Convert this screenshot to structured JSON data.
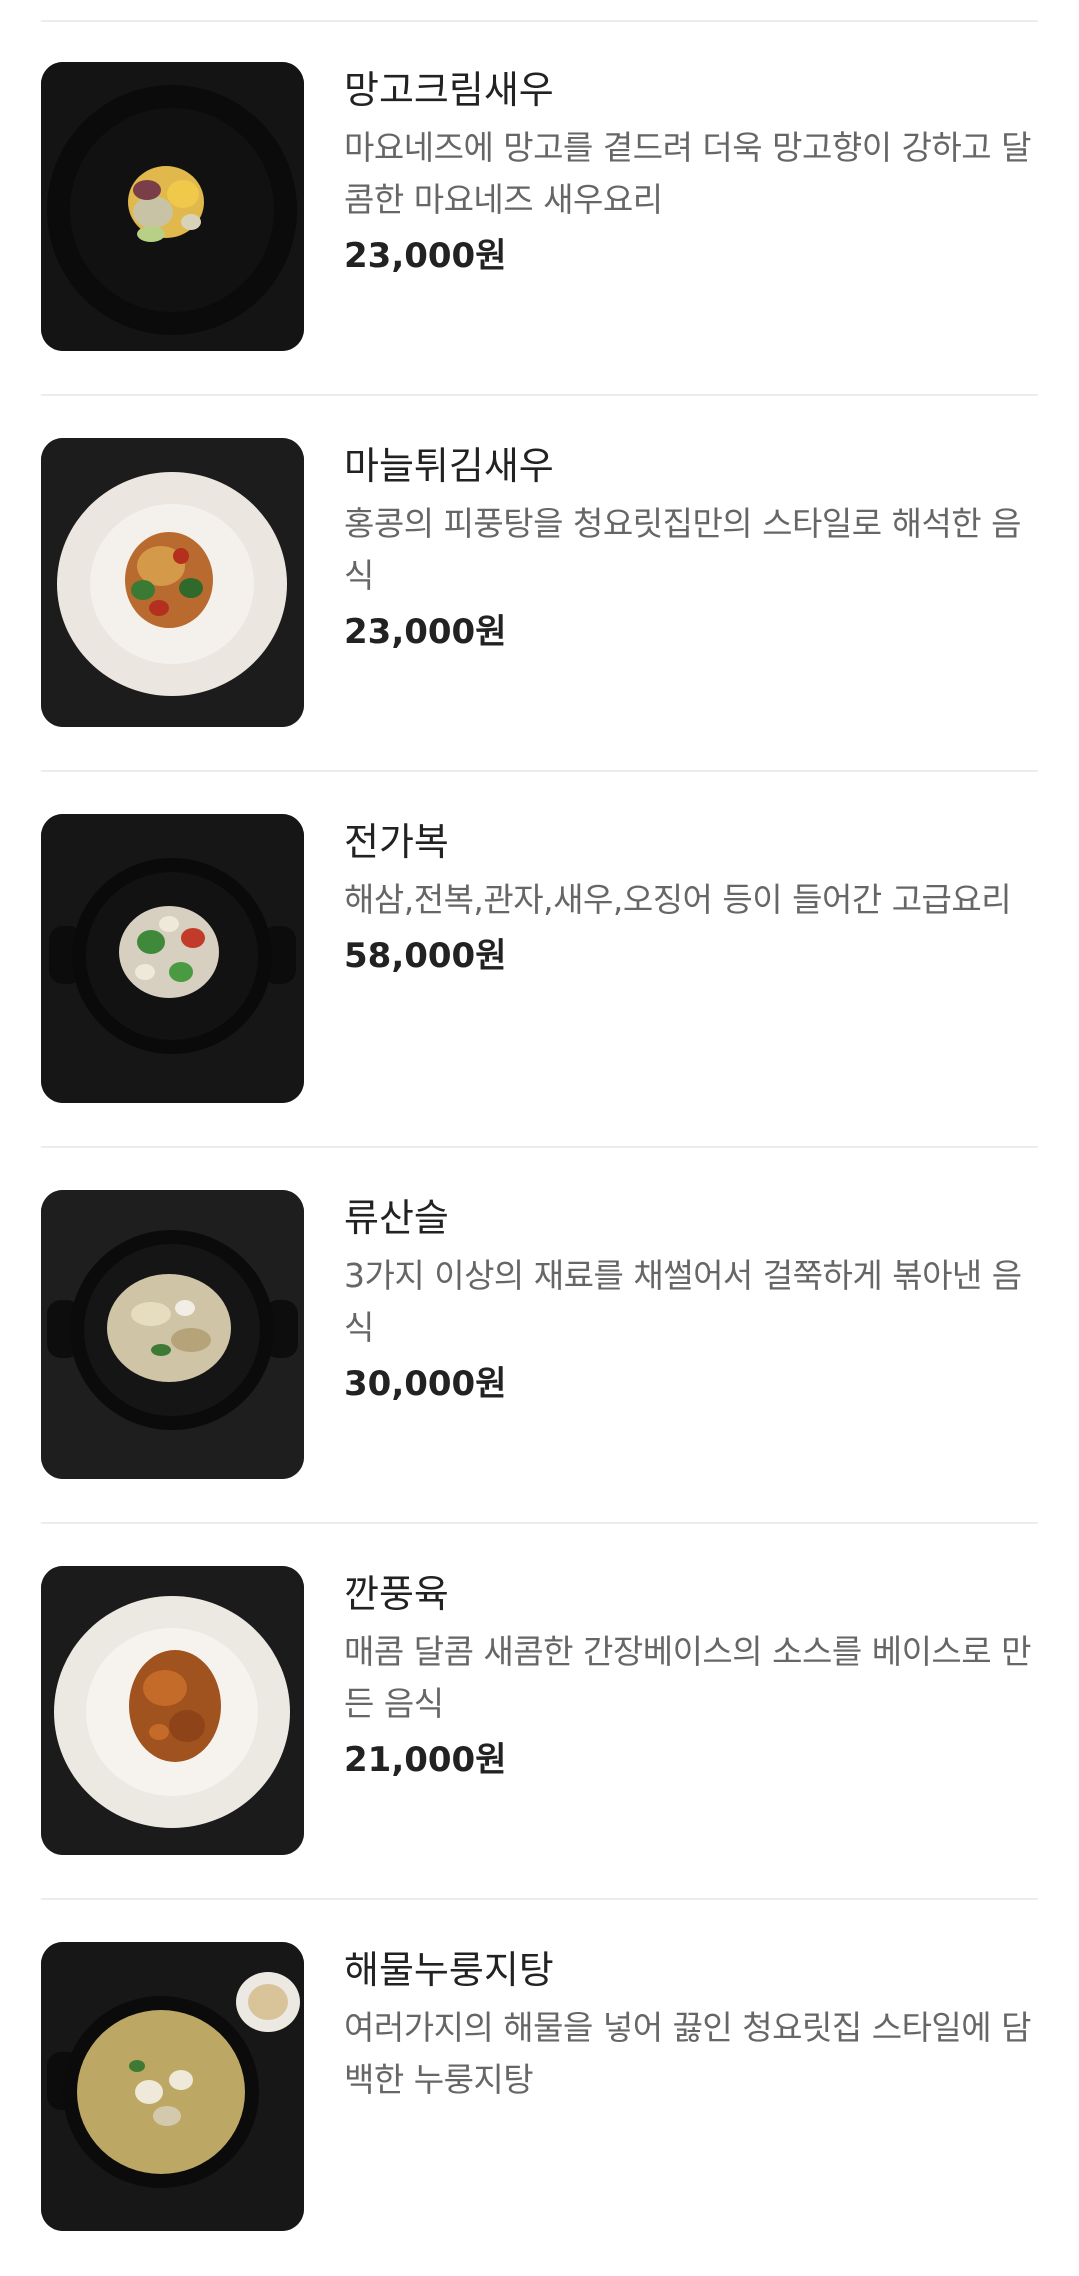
{
  "menu": {
    "items": [
      {
        "name": "망고크림새우",
        "description": "마요네즈에 망고를 곁드려 더욱 망고향이 강하고 달콤한 마요네즈 새우요리",
        "price": "23,000원",
        "image_icon": "food-photo-icon"
      },
      {
        "name": "마늘튀김새우",
        "description": "홍콩의 피풍탕을 청요릿집만의 스타일로 해석한 음식",
        "price": "23,000원",
        "image_icon": "food-photo-icon"
      },
      {
        "name": "전가복",
        "description": "해삼,전복,관자,새우,오징어 등이 들어간 고급요리",
        "price": "58,000원",
        "image_icon": "food-photo-icon"
      },
      {
        "name": "류산슬",
        "description": "3가지 이상의 재료를 채썰어서 걸쭉하게 볶아낸 음식",
        "price": "30,000원",
        "image_icon": "food-photo-icon"
      },
      {
        "name": "깐풍육",
        "description": "매콤 달콤 새콤한 간장베이스의 소스를 베이스로 만든 음식",
        "price": "21,000원",
        "image_icon": "food-photo-icon"
      },
      {
        "name": "해물누룽지탕",
        "description": "여러가지의 해물을 넣어 끓인 청요릿집 스타일에 담백한 누룽지탕",
        "price": "",
        "image_icon": "food-photo-icon"
      }
    ]
  },
  "colors": {
    "background": "#ffffff",
    "divider": "#ededed",
    "name_text": "#222222",
    "description_text": "#666666",
    "price_text": "#222222"
  }
}
